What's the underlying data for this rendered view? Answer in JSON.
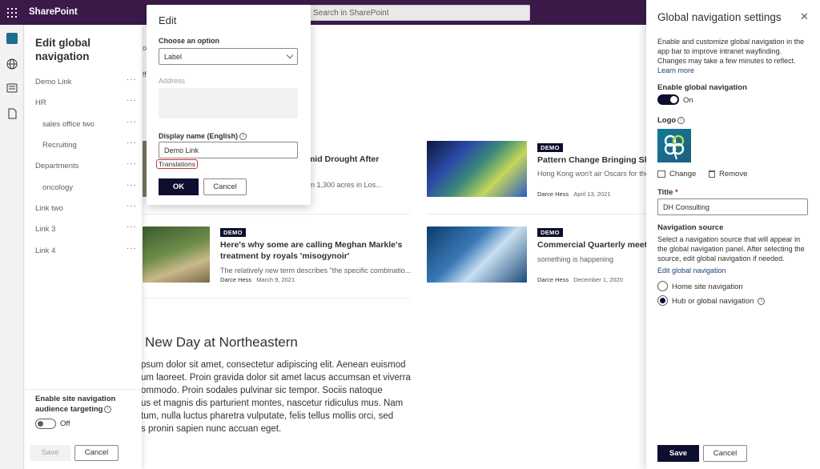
{
  "topbar": {
    "brand": "SharePoint",
    "search_placeholder": "Search in SharePoint"
  },
  "left_panel": {
    "title": "Edit global navigation",
    "items": [
      {
        "label": "Demo Link",
        "level": 0
      },
      {
        "label": "HR",
        "level": 0
      },
      {
        "label": "sales office two",
        "level": 1
      },
      {
        "label": "Recruiting",
        "level": 1
      },
      {
        "label": "Departments",
        "level": 0
      },
      {
        "label": "oncology",
        "level": 1
      },
      {
        "label": "Link two",
        "level": 0
      },
      {
        "label": "Link 3",
        "level": 0
      },
      {
        "label": "Link 4",
        "level": 0
      }
    ],
    "more_glyph": "···",
    "enable_audience": "Enable site navigation audience targeting",
    "toggle_state": "Off",
    "save_label": "Save",
    "cancel_label": "Cancel"
  },
  "edit_popup": {
    "title": "Edit",
    "choose_label": "Choose an option",
    "choose_value": "Label",
    "address_label": "Address",
    "display_label": "Display name (English)",
    "display_value": "Demo Link",
    "translations_link": "Translations",
    "ok_label": "OK",
    "cancel_label": "Cancel"
  },
  "content": {
    "fragment_top": "ou",
    "fragment_mid": "ff",
    "cards": [
      {
        "badge": "",
        "title": "e Amid Drought After",
        "title2": "n",
        "desc": "e than 1,300 acres in Los...",
        "author": "",
        "date": ""
      },
      {
        "badge": "DEMO",
        "title": "Pattern Change Bringing Sho",
        "title2": "",
        "desc": "Hong Kong won't air Oscars for the",
        "author": "Darce Hess",
        "date": "April 13, 2021"
      },
      {
        "badge": "DEMO",
        "title": "Here's why some are calling Meghan Markle's",
        "title2": "treatment by royals 'misogynoir'",
        "desc": "The relatively new term describes \"the specific combinatio...",
        "author": "Darce Hess",
        "date": "March 9, 2021"
      },
      {
        "badge": "DEMO",
        "title": "Commercial Quarterly meetin",
        "title2": "",
        "desc": "something is happening",
        "author": "Darce Hess",
        "date": "December 1, 2020"
      }
    ],
    "hero_title": "New Day at Northeastern",
    "body_lines": [
      "psum dolor sit amet, consectetur adipiscing elit. Aenean euismod",
      "um laoreet. Proin gravida dolor sit amet lacus accumsan et viverra",
      "ommodo. Proin sodales pulvinar sic tempor. Sociis natoque",
      "us et magnis dis parturient montes, nascetur ridiculus mus. Nam",
      "tum, nulla luctus pharetra vulputate, felis tellus mollis orci, sed",
      "s pronin sapien nunc accuan eget."
    ]
  },
  "right_panel": {
    "title": "Global navigation settings",
    "description": "Enable and customize global navigation in the app bar to improve intranet wayfinding. Changes may take a few minutes to reflect.",
    "learn_more": "Learn more",
    "enable_label": "Enable global navigation",
    "toggle_state": "On",
    "logo_label": "Logo",
    "change_label": "Change",
    "remove_label": "Remove",
    "title_label": "Title",
    "required_mark": "*",
    "title_value": "DH Consulting",
    "source_label": "Navigation source",
    "source_desc": "Select a navigation source that will appear in the global navigation panel. After selecting the source, edit global navigation if needed.",
    "edit_link": "Edit global navigation",
    "options": [
      "Home site navigation",
      "Hub or global navigation"
    ],
    "selected_option": "Hub or global navigation",
    "save_label": "Save",
    "cancel_label": "Cancel"
  },
  "colors": {
    "suite_bar": "#3b1a4a",
    "primary": "#0e0e2e",
    "link": "#1a3f7a",
    "error": "#d13438"
  }
}
